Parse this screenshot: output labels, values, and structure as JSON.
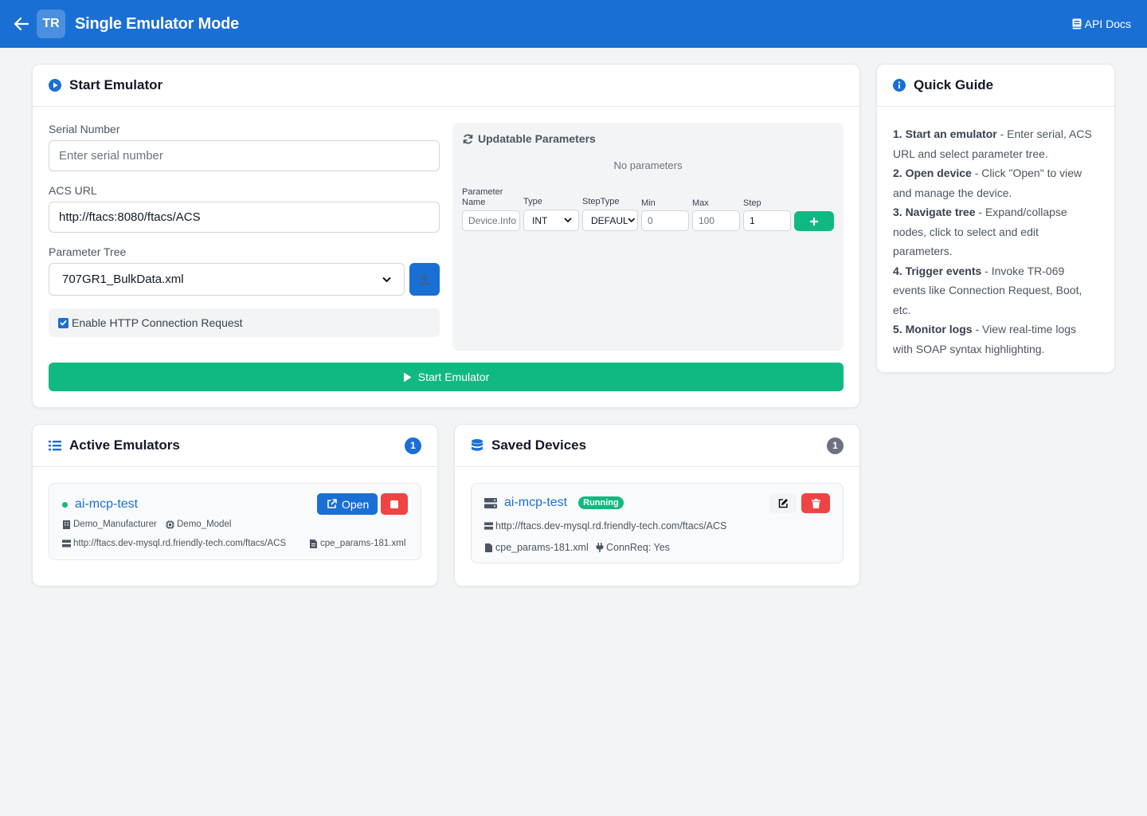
{
  "header": {
    "logo_text": "TR",
    "title": "Single Emulator Mode",
    "api_docs_label": "API Docs"
  },
  "start_card": {
    "title": "Start Emulator",
    "serial": {
      "label": "Serial Number",
      "placeholder": "Enter serial number",
      "value": ""
    },
    "acs": {
      "label": "ACS URL",
      "value": "http://ftacs:8080/ftacs/ACS"
    },
    "tree": {
      "label": "Parameter Tree",
      "selected": "707GR1_BulkData.xml"
    },
    "http_conn_label": "Enable HTTP Connection Request",
    "http_conn_checked": true,
    "params": {
      "title": "Updatable Parameters",
      "empty_text": "No parameters",
      "name_label": "Parameter Name",
      "name_placeholder": "Device.Info",
      "type_label": "Type",
      "type_value": "INT",
      "steptype_label": "StepType",
      "steptype_value": "DEFAULT",
      "min_label": "Min",
      "min_placeholder": "0",
      "max_label": "Max",
      "max_placeholder": "100",
      "step_label": "Step",
      "step_value": "1"
    },
    "start_button_label": "Start Emulator"
  },
  "quick_guide": {
    "title": "Quick Guide",
    "steps": [
      {
        "title": "1. Start an emulator",
        "text": " - Enter serial, ACS URL and select parameter tree."
      },
      {
        "title": "2. Open device",
        "text": " - Click \"Open\" to view and manage the device."
      },
      {
        "title": "3. Navigate tree",
        "text": " - Expand/collapse nodes, click to select and edit parameters."
      },
      {
        "title": "4. Trigger events",
        "text": " - Invoke TR-069 events like Connection Request, Boot, etc."
      },
      {
        "title": "5. Monitor logs",
        "text": " - View real-time logs with SOAP syntax highlighting."
      }
    ]
  },
  "active_emulators": {
    "title": "Active Emulators",
    "count": "1",
    "items": [
      {
        "name": "ai-mcp-test",
        "manufacturer": "Demo_Manufacturer",
        "model": "Demo_Model",
        "acs_url": "http://ftacs.dev-mysql.rd.friendly-tech.com/ftacs/ACS",
        "params_file": "cpe_params-181.xml",
        "open_label": "Open"
      }
    ]
  },
  "saved_devices": {
    "title": "Saved Devices",
    "count": "1",
    "items": [
      {
        "name": "ai-mcp-test",
        "status": "Running",
        "acs_url": "http://ftacs.dev-mysql.rd.friendly-tech.com/ftacs/ACS",
        "params_file": "cpe_params-181.xml",
        "conn_req": "ConnReq: Yes"
      }
    ]
  },
  "colors": {
    "primary": "#1a6fd4",
    "success": "#10b981",
    "danger": "#ef4444",
    "muted_badge": "#6b7280",
    "background": "#f3f4f6"
  },
  "icons": {
    "back": "arrow-left-icon",
    "api_docs": "book-icon",
    "start_card": "play-circle-icon",
    "params": "sync-icon",
    "upload": "upload-icon",
    "guide": "info-circle-icon",
    "active": "list-icon",
    "saved": "database-icon",
    "server": "server-icon",
    "building": "building-icon",
    "chip": "chip-icon",
    "file": "file-icon",
    "plug": "plug-icon",
    "external": "external-link-icon",
    "stop": "stop-icon",
    "edit": "edit-icon",
    "trash": "trash-icon"
  }
}
